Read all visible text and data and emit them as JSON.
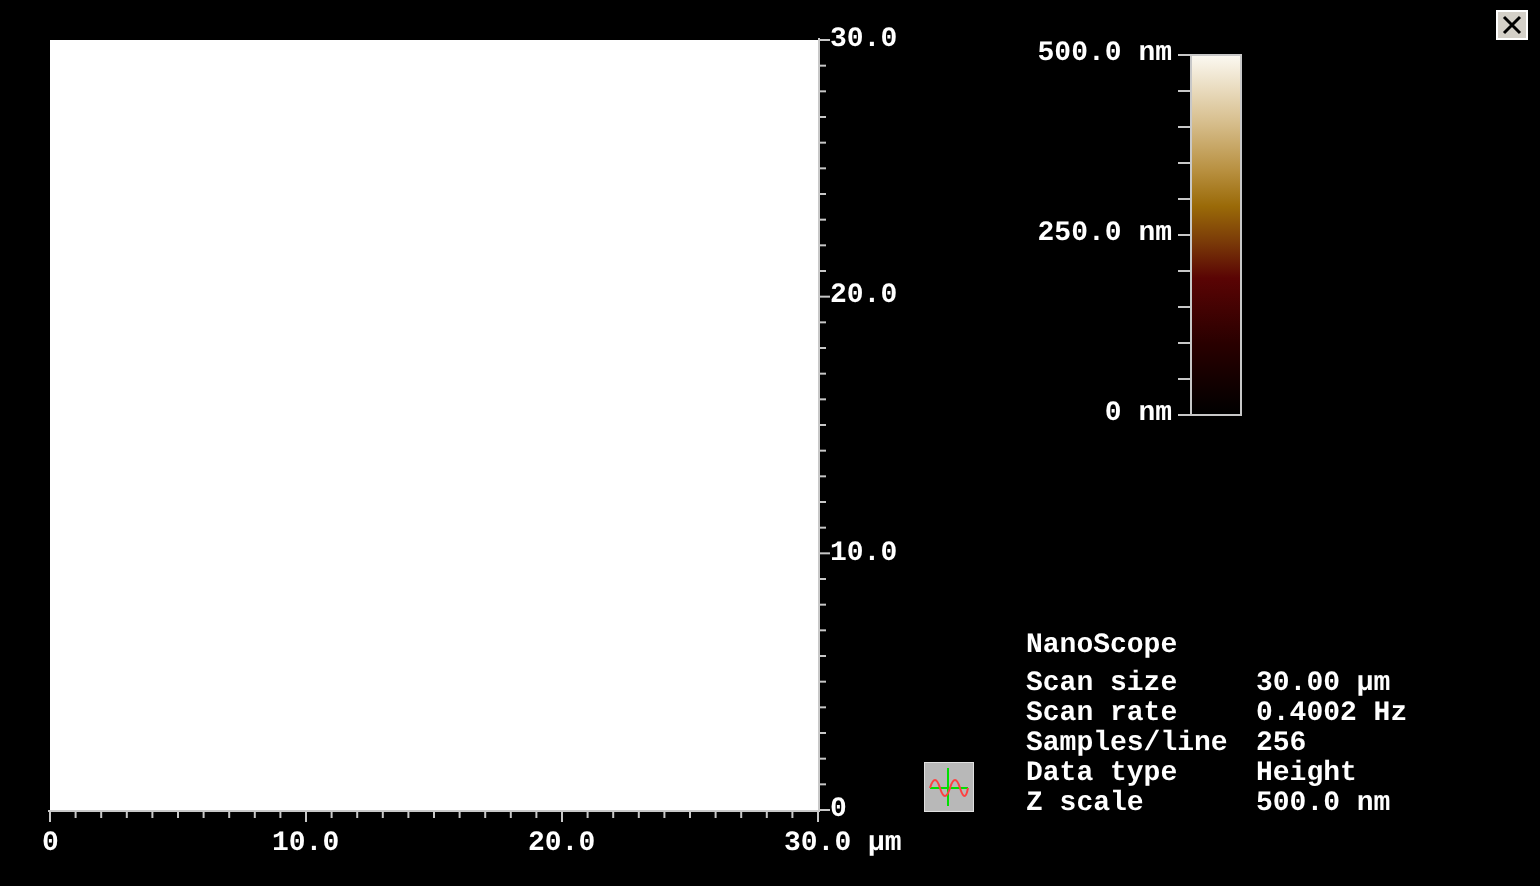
{
  "y_axis": {
    "labels": [
      "30.0",
      "20.0",
      "10.0",
      "0"
    ]
  },
  "x_axis": {
    "labels": [
      "0",
      "10.0",
      "20.0",
      "30.0 µm"
    ]
  },
  "color_scale": {
    "labels": [
      "500.0 nm",
      "250.0 nm",
      "0 nm"
    ]
  },
  "info": {
    "title": "NanoScope",
    "rows": [
      {
        "label": "Scan size",
        "value": "30.00 µm"
      },
      {
        "label": "Scan rate",
        "value": "0.4002 Hz"
      },
      {
        "label": "Samples/line",
        "value": "256"
      },
      {
        "label": "Data type",
        "value": "Height"
      },
      {
        "label": "Z scale",
        "value": "500.0 nm"
      }
    ]
  }
}
